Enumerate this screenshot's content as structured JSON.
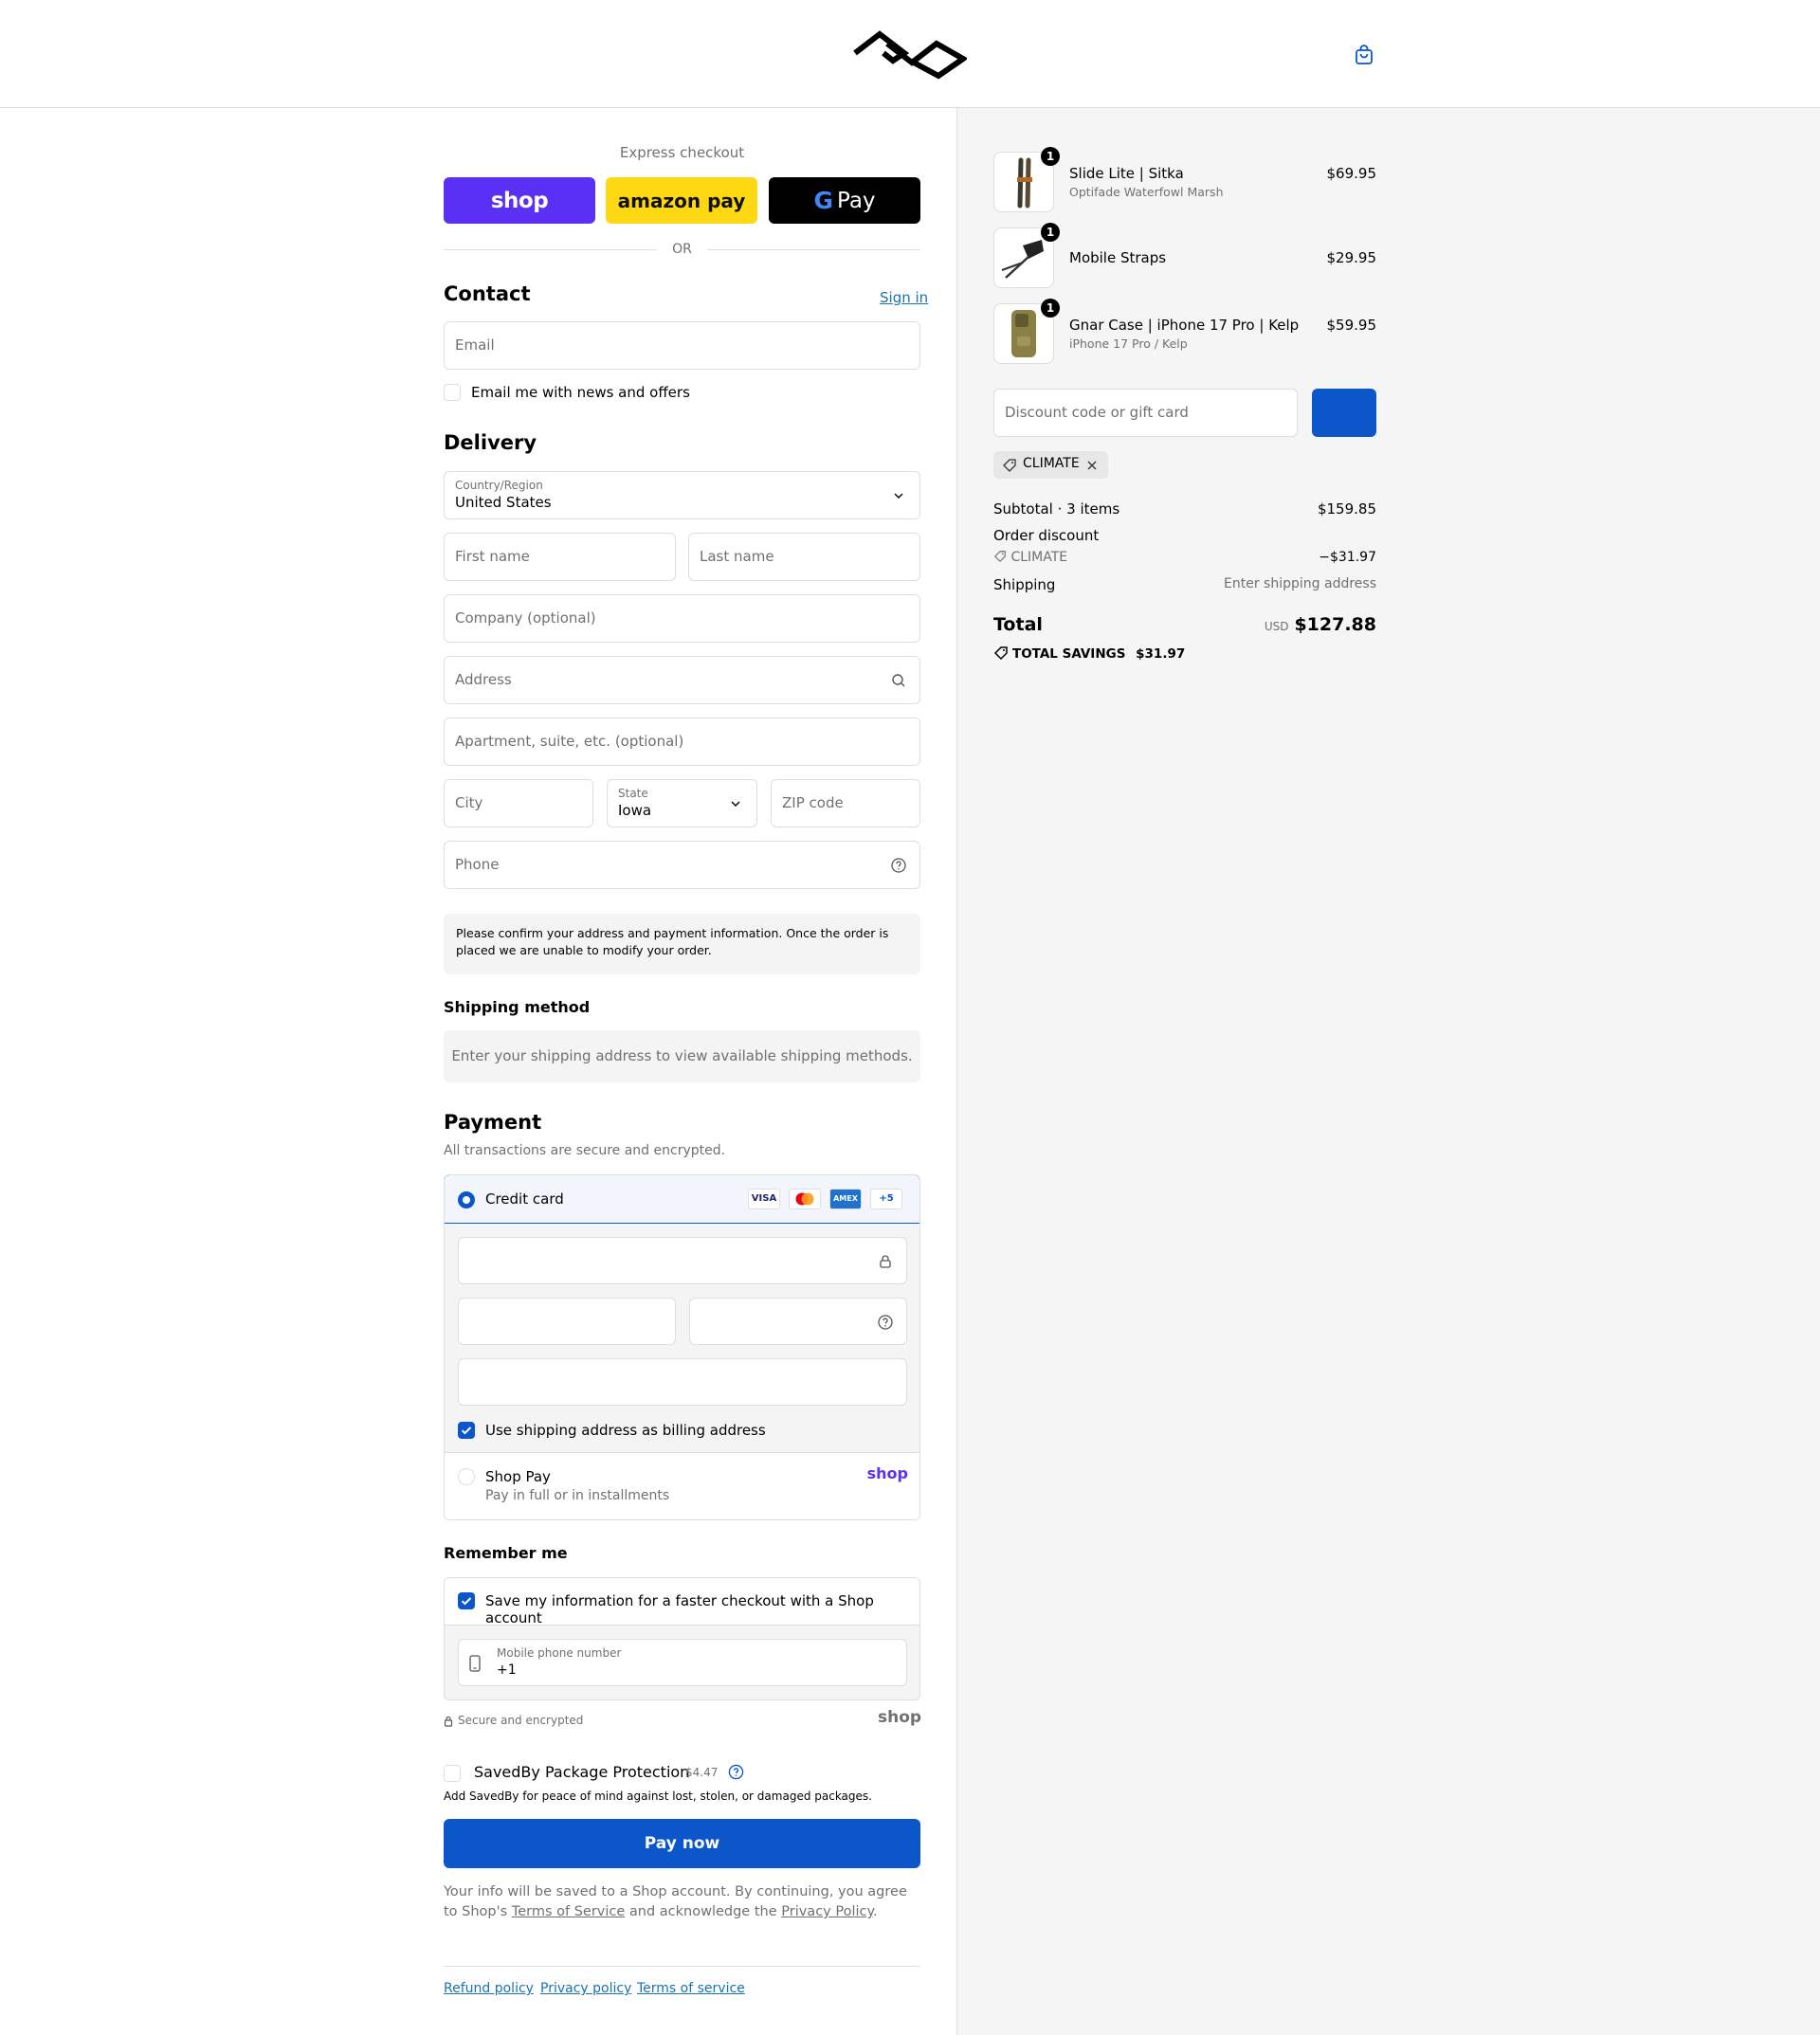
{
  "header": {
    "logo": "peak-design-logo",
    "cart_icon": "bag-icon"
  },
  "express": {
    "label": "Express checkout",
    "shop": "shop",
    "amazon": "amazon pay",
    "gpay": "Pay",
    "or": "OR"
  },
  "contact": {
    "title": "Contact",
    "sign_in": "Sign in",
    "email_placeholder": "Email",
    "news_label": "Email me with news and offers"
  },
  "delivery": {
    "title": "Delivery",
    "country_label": "Country/Region",
    "country_value": "United States",
    "first_name": "First name",
    "last_name": "Last name",
    "company": "Company (optional)",
    "address": "Address",
    "apartment": "Apartment, suite, etc. (optional)",
    "city": "City",
    "state_label": "State",
    "state_value": "Iowa",
    "zip": "ZIP code",
    "phone": "Phone",
    "notice": "Please confirm your address and payment information. Once the order is placed we are unable to modify your order."
  },
  "shipping_method": {
    "title": "Shipping method",
    "message": "Enter your shipping address to view available shipping methods."
  },
  "payment": {
    "title": "Payment",
    "subtitle": "All transactions are secure and encrypted.",
    "credit_card": "Credit card",
    "cards": [
      "VISA",
      "MC",
      "AMEX",
      "+5"
    ],
    "billing_label": "Use shipping address as billing address",
    "shop_pay": "Shop Pay",
    "shop_pay_sub": "Pay in full or in installments",
    "shop_logo": "shop"
  },
  "remember": {
    "title": "Remember me",
    "save_label": "Save my information for a faster checkout with a Shop account",
    "mobile_label": "Mobile phone number",
    "mobile_value": "+1",
    "secure": "Secure and encrypted",
    "shop_logo": "shop"
  },
  "savedby": {
    "label": "SavedBy Package Protection",
    "price": "$4.47",
    "desc": "Add SavedBy for peace of mind against lost, stolen, or damaged packages."
  },
  "pay_now": "Pay now",
  "legal": {
    "text1": "Your info will be saved to a Shop account. By continuing, you agree to Shop's",
    "terms": "Terms of Service",
    "text2": "and acknowledge the",
    "privacy": "Privacy Policy",
    "period": "."
  },
  "footer": [
    "Refund policy",
    "Privacy policy",
    "Terms of service"
  ],
  "cart": {
    "items": [
      {
        "name": "Slide Lite | Sitka",
        "variant": "Optifade Waterfowl Marsh",
        "price": "$69.95",
        "qty": "1"
      },
      {
        "name": "Mobile Straps",
        "variant": "",
        "price": "$29.95",
        "qty": "1"
      },
      {
        "name": "Gnar Case | iPhone 17 Pro | Kelp",
        "variant": "iPhone 17 Pro / Kelp",
        "price": "$59.95",
        "qty": "1"
      }
    ],
    "discount_placeholder": "Discount code or gift card",
    "discount_tag": "CLIMATE",
    "subtotal_label": "Subtotal · 3 items",
    "subtotal_value": "$159.85",
    "order_discount_label": "Order discount",
    "code_label": "CLIMATE",
    "code_value": "−$31.97",
    "shipping_label": "Shipping",
    "shipping_value": "Enter shipping address",
    "total_label": "Total",
    "currency": "USD",
    "total_value": "$127.88",
    "savings_label": "TOTAL SAVINGS",
    "savings_value": "$31.97"
  },
  "colors": {
    "accent": "#0b56c8",
    "shop_purple": "#5a31f4",
    "amazon_yellow": "#ffd814"
  }
}
